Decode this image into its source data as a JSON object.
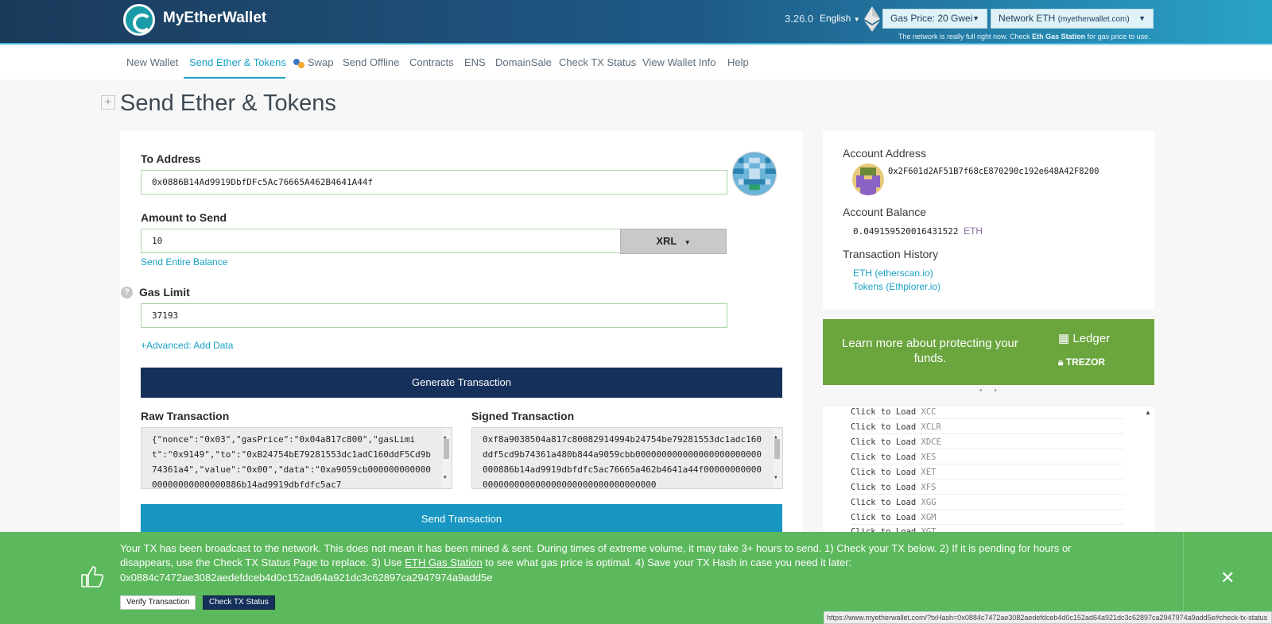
{
  "header": {
    "brand": "MyEtherWallet",
    "version": "3.26.0",
    "language": "English",
    "gas_price": "Gas Price: 20 Gwei",
    "network": "Network ETH",
    "network_host": "(myetherwallet.com)",
    "note_prefix": "The network is really full right now. Check",
    "note_link": "Eth Gas Station",
    "note_suffix": "for gas price to use."
  },
  "nav": {
    "items": [
      "New Wallet",
      "Send Ether & Tokens",
      "Swap",
      "Send Offline",
      "Contracts",
      "ENS",
      "DomainSale",
      "Check TX Status",
      "View Wallet Info",
      "Help"
    ],
    "active": "Send Ether & Tokens"
  },
  "page": {
    "title": "Send Ether & Tokens",
    "expand": "+"
  },
  "form": {
    "to_label": "To Address",
    "to_value": "0x0886B14Ad9919DbfDFc5Ac76665A462B4641A44f",
    "amount_label": "Amount to Send",
    "amount_value": "10",
    "token": "XRL",
    "send_entire": "Send Entire Balance",
    "gas_label": "Gas Limit",
    "gas_value": "37193",
    "advanced": "+Advanced: Add Data",
    "generate": "Generate Transaction",
    "raw_label": "Raw Transaction",
    "raw_value": "{\"nonce\":\"0x03\",\"gasPrice\":\"0x04a817c800\",\"gasLimit\":\"0x9149\",\"to\":\"0xB24754bE79281553dc1adC160ddF5Cd9b74361a4\",\"value\":\"0x00\",\"data\":\"0xa9059cb00000000000000000000000000886b14ad9919dbfdfc5ac7",
    "signed_label": "Signed Transaction",
    "signed_value": "0xf8a9038504a817c80082914994b24754be79281553dc1adc160ddf5cd9b74361a480b844a9059cbb000000000000000000000000000886b14ad9919dbfdfc5ac76665a462b4641a44f00000000000000000000000000000000000000000000",
    "send": "Send Transaction"
  },
  "account": {
    "address_label": "Account Address",
    "address": "0x2F601d2AF51B7f68cE870290c192e648A42F8200",
    "balance_label": "Account Balance",
    "balance": "0.049159520016431522",
    "balance_unit": "ETH",
    "history_label": "Transaction History",
    "history_links": [
      "ETH (etherscan.io)",
      "Tokens (Ethplorer.io)"
    ]
  },
  "promo": {
    "text": "Learn more about protecting your funds.",
    "ledger": "Ledger",
    "trezor": "TREZOR",
    "dots": "• •"
  },
  "token_list": {
    "load_label": "Click to Load",
    "tokens": [
      "XCC",
      "XCLR",
      "XDCE",
      "XES",
      "XET",
      "XFS",
      "XGG",
      "XGM",
      "XGT"
    ]
  },
  "notification": {
    "message_1": "Your TX has been broadcast to the network. This does not mean it has been mined & sent. During times of extreme volume, it may take 3+ hours to send. 1) Check your TX below. 2) If it is pending for hours or disappears, use the Check TX Status Page to replace. 3) Use",
    "gas_link": "ETH Gas Station",
    "message_2": "to see what gas price is optimal. 4) Save your TX Hash in case you need it later:",
    "hash": "0x0884c7472ae3082aedefdceb4d0c152ad64a921dc3c62897ca2947974a9add5e",
    "verify": "Verify Transaction",
    "check": "Check TX Status",
    "close": "✕"
  },
  "status_url": "https://www.myetherwallet.com/?txHash=0x0884c7472ae3082aedefdceb4d0c152ad64a921dc3c62897ca2947974a9add5e#check-tx-status",
  "colors": {
    "header_dark": "#1b3a5a",
    "accent": "#1aa1c4",
    "success": "#5cb85c",
    "primary_btn": "#15305a",
    "promo": "#6ba53e"
  }
}
